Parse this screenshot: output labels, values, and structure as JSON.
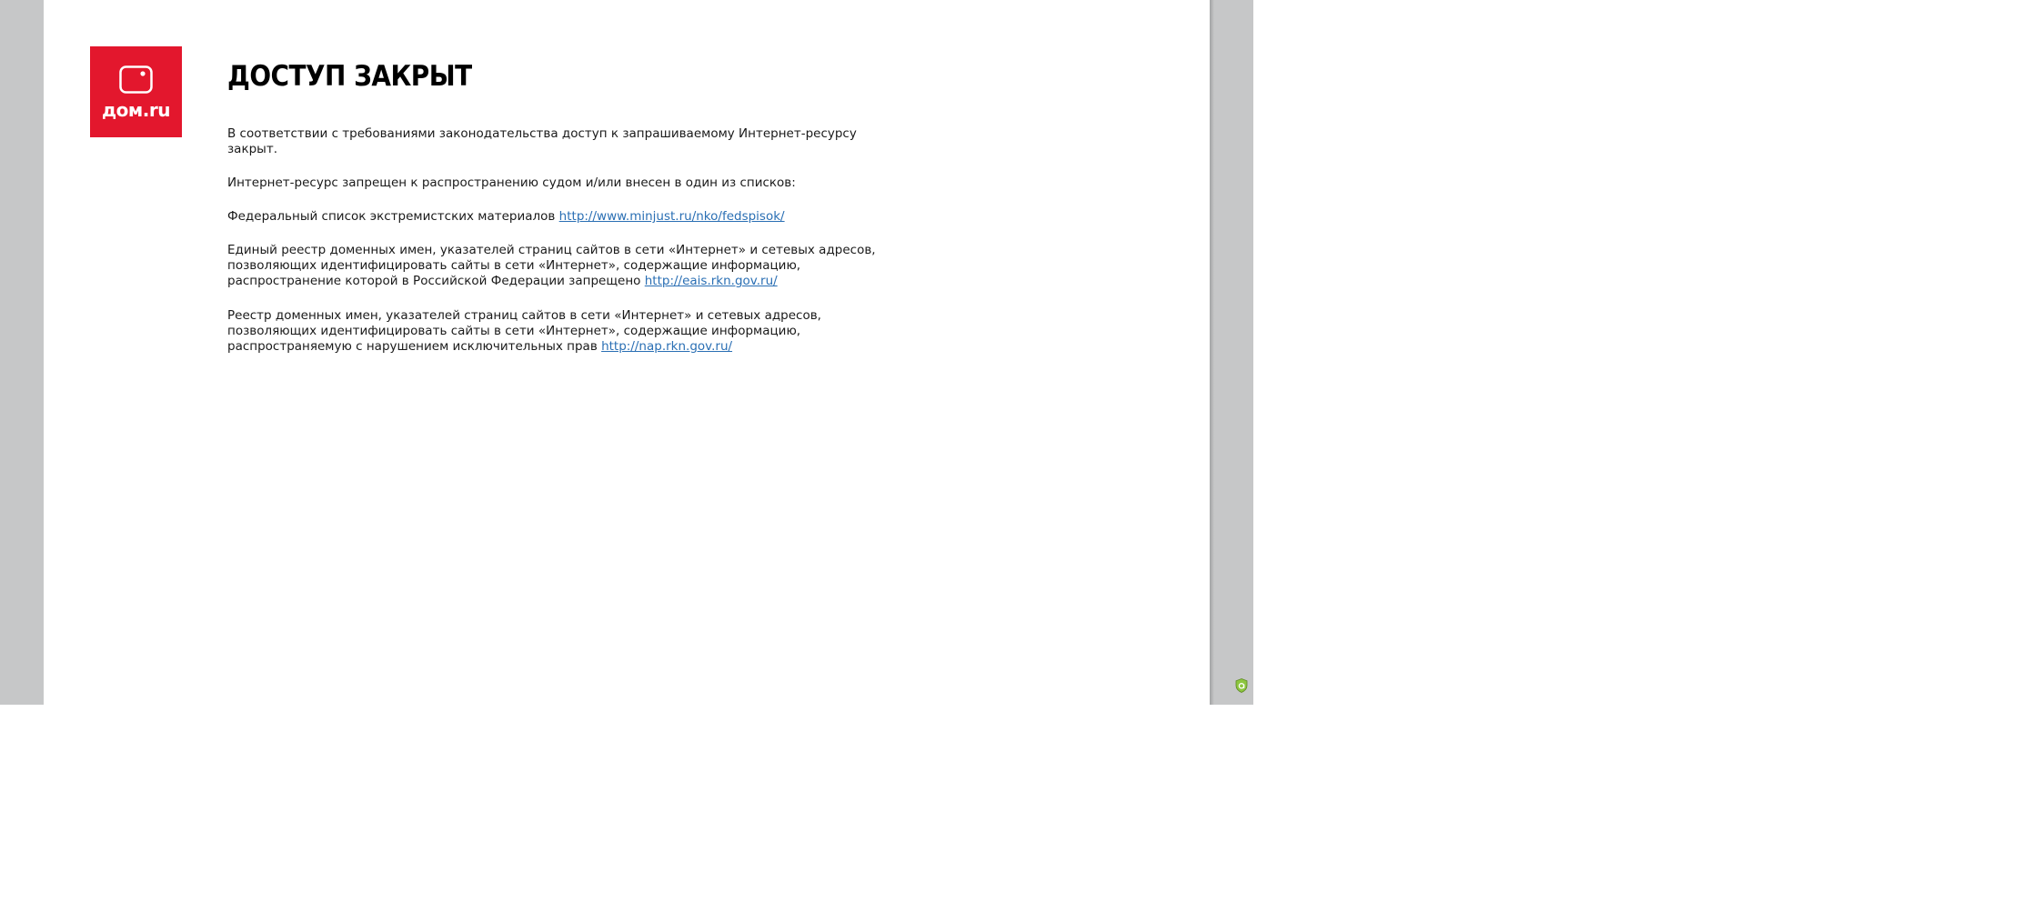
{
  "logo": {
    "text": "дом.ru",
    "icon": "tv-icon",
    "color": "#e3172d"
  },
  "title": "ДОСТУП ЗАКРЫТ",
  "paragraphs": {
    "intro": "В соответствии с требованиями законодательства доступ к запрашиваемому Интернет-ресурсу закрыт.",
    "reason": "Интернет-ресурс запрещен к распространению судом и/или внесен в один из списков:",
    "list1_text": "Федеральный список экстремистских материалов ",
    "list1_link": "http://www.minjust.ru/nko/fedspisok/",
    "list2_text": "Единый реестр доменных имен, указателей страниц сайтов в сети «Интернет» и сетевых адресов, позволяющих идентифицировать сайты в сети «Интернет», содержащие информацию, распространение которой в Российской Федерации запрещено ",
    "list2_link": "http://eais.rkn.gov.ru/",
    "list3_text": "Реестр доменных имен, указателей страниц сайтов в сети «Интернет» и сетевых адресов, позволяющих идентифицировать сайты в сети «Интернет», содержащие информацию, распространяемую с нарушением исключительных прав ",
    "list3_link": "http://nap.rkn.gov.ru/"
  },
  "corner_badge": {
    "icon": "shield-icon",
    "color": "#8dc63f"
  },
  "colors": {
    "link": "#2a6fb4",
    "background_gray": "#c6c7c8"
  }
}
